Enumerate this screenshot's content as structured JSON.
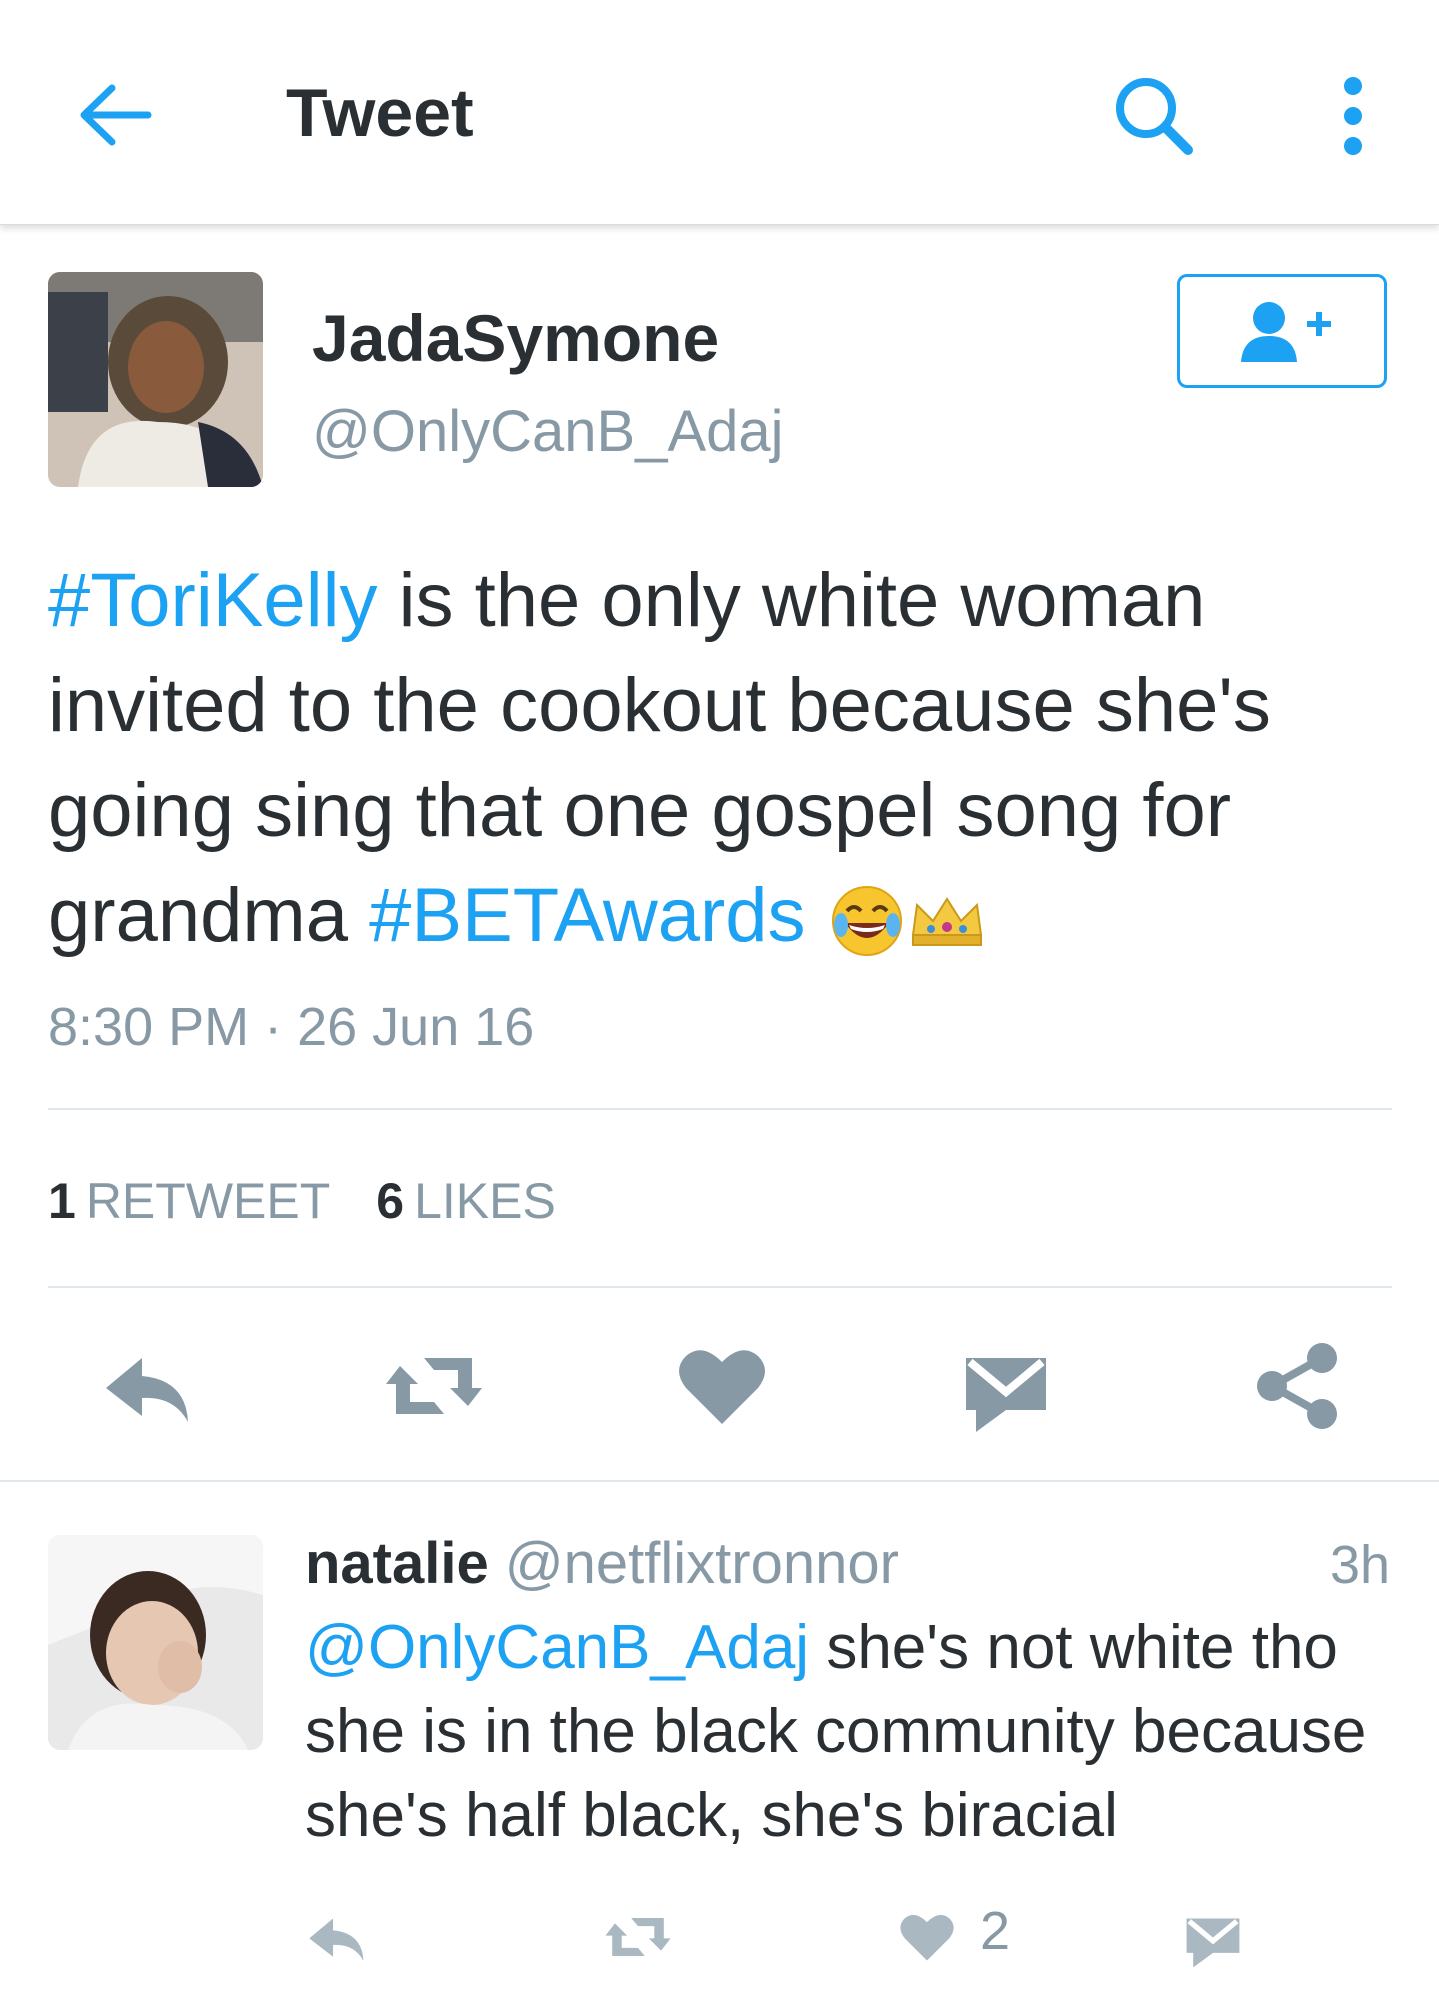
{
  "header": {
    "title": "Tweet",
    "back_icon": "arrow-left-icon",
    "search_icon": "search-icon",
    "more_icon": "more-vertical-icon",
    "accent": "#1da1f2"
  },
  "tweet": {
    "author": {
      "name": "JadaSymone",
      "handle": "@OnlyCanB_Adaj",
      "avatar": "avatar"
    },
    "follow_icon": "follow-user-icon",
    "text": {
      "hashtag1": "#ToriKelly",
      "part1": " is the only white woman invited to the cookout because she's going sing that one gospel song for grandma ",
      "hashtag2": "#BETAwards",
      "emojis": [
        "tears-of-joy-emoji",
        "crown-emoji"
      ]
    },
    "timestamp": "8:30 PM · 26 Jun 16",
    "stats": {
      "retweet_count": "1",
      "retweet_label": "RETWEET",
      "like_count": "6",
      "like_label": "LIKES"
    },
    "actions": [
      "reply-icon",
      "retweet-icon",
      "heart-icon",
      "message-icon",
      "share-icon"
    ]
  },
  "reply": {
    "name": "natalie",
    "handle": "@netflixtronnor",
    "time": "3h",
    "mention": "@OnlyCanB_Adaj",
    "text": " she's not white tho she is in the black community because she's half black, she's biracial",
    "like_count": "2",
    "actions": [
      "reply-icon",
      "retweet-icon",
      "heart-icon",
      "message-icon"
    ]
  }
}
